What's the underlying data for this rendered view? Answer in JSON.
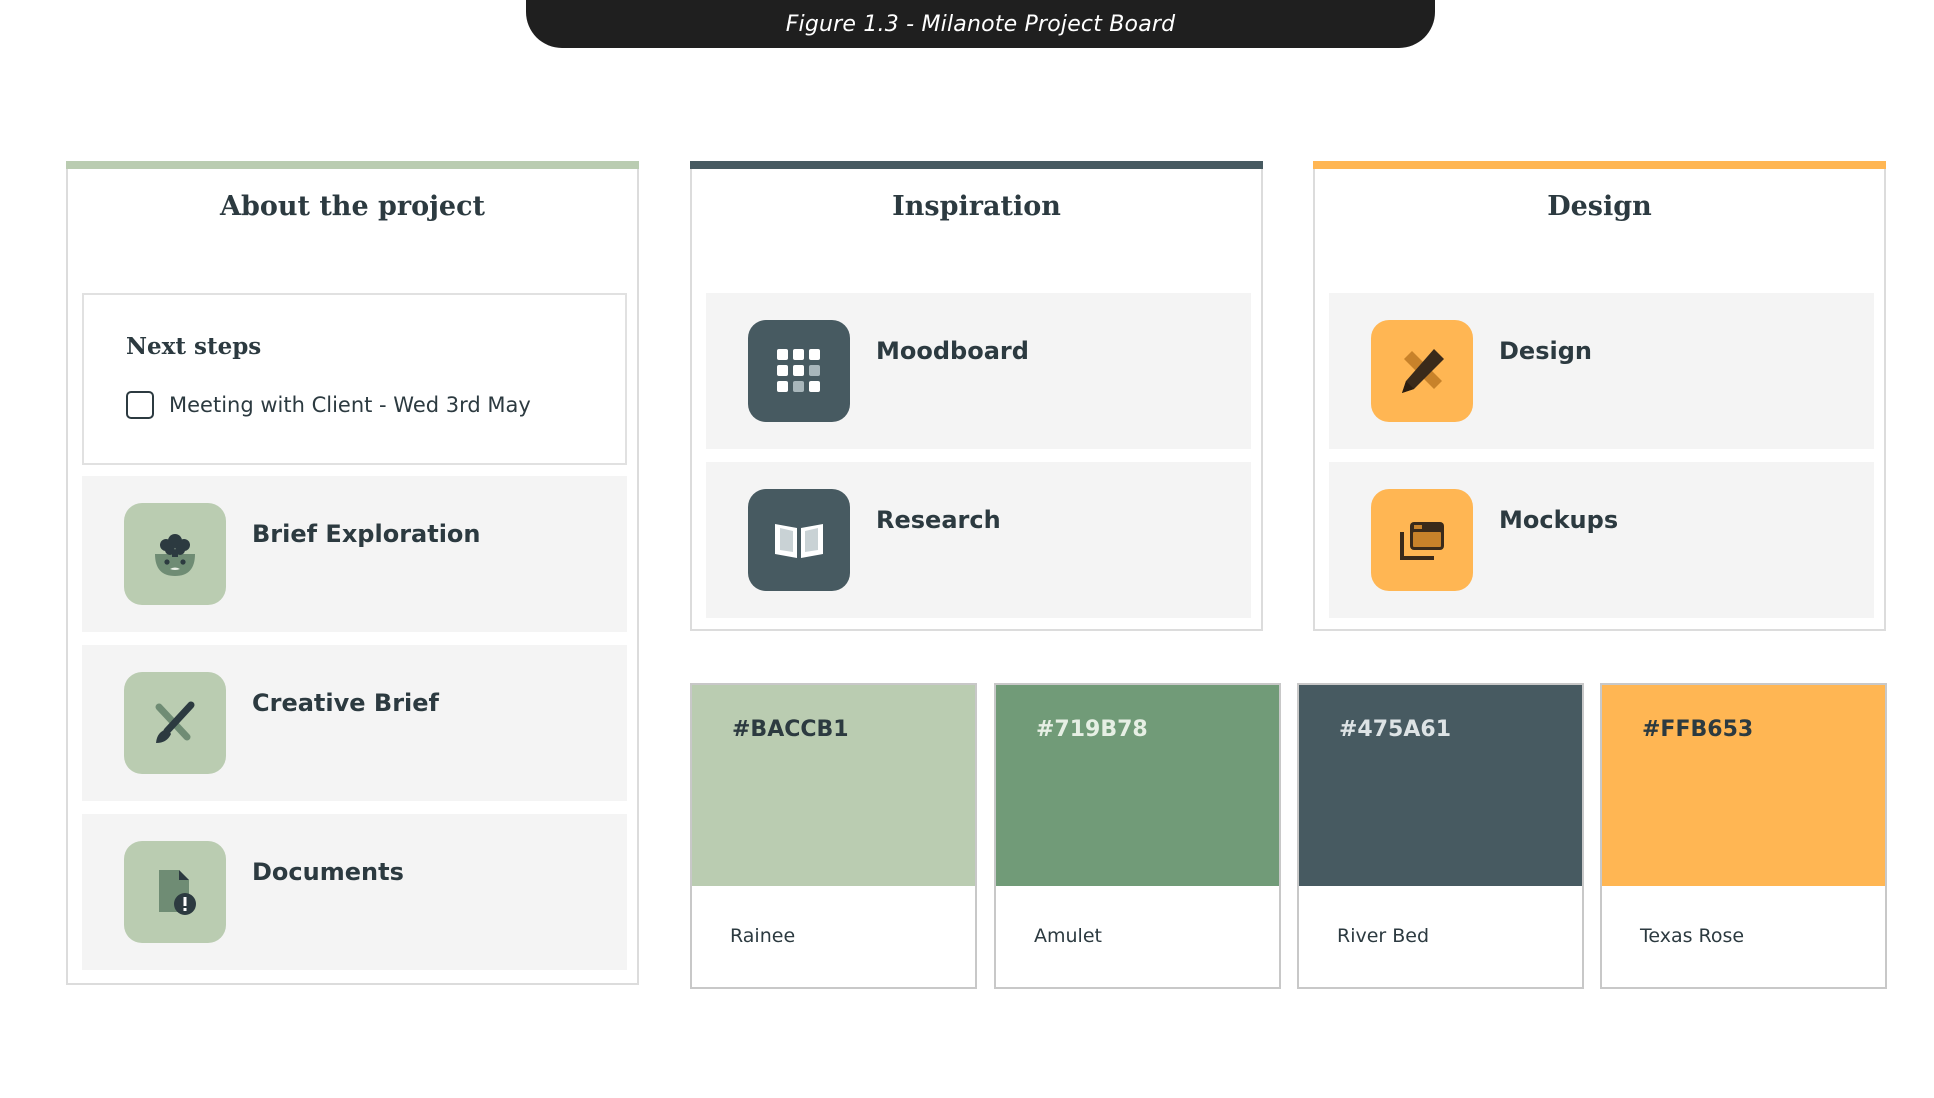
{
  "caption": "Figure 1.3 - Milanote Project Board",
  "colors": {
    "rainee": "#BACCB1",
    "amulet": "#719B78",
    "river_bed": "#475A61",
    "texas_rose": "#FFB653",
    "card_bg": "#F4F4F4",
    "text_dark": "#2C3A40"
  },
  "about": {
    "title": "About the project",
    "next_steps": {
      "title": "Next steps",
      "task": "Meeting with Client - Wed 3rd May",
      "task_checked": false
    },
    "cards": [
      {
        "label": "Brief Exploration",
        "icon": "brain-head-icon"
      },
      {
        "label": "Creative Brief",
        "icon": "pen-brush-crossed-icon"
      },
      {
        "label": "Documents",
        "icon": "document-alert-icon"
      }
    ]
  },
  "inspiration": {
    "title": "Inspiration",
    "cards": [
      {
        "label": "Moodboard",
        "icon": "grid-dots-icon"
      },
      {
        "label": "Research",
        "icon": "open-book-icon"
      }
    ]
  },
  "design": {
    "title": "Design",
    "cards": [
      {
        "label": "Design",
        "icon": "pencil-ruler-icon"
      },
      {
        "label": "Mockups",
        "icon": "browser-windows-icon"
      }
    ]
  },
  "palette": [
    {
      "hex": "#BACCB1",
      "name": "Rainee"
    },
    {
      "hex": "#719B78",
      "name": "Amulet"
    },
    {
      "hex": "#475A61",
      "name": "River Bed"
    },
    {
      "hex": "#FFB653",
      "name": "Texas Rose"
    }
  ]
}
